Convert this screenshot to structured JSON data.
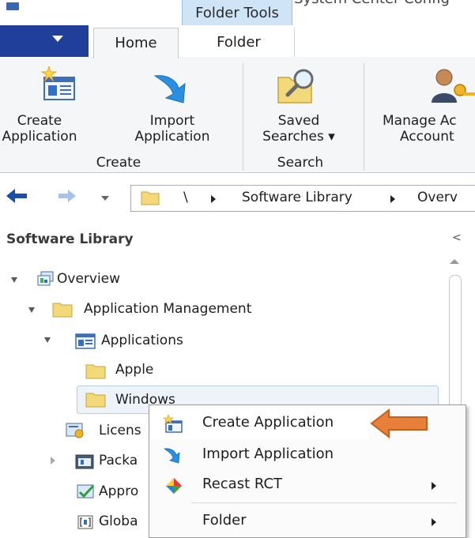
{
  "window": {
    "context_tab": "Folder Tools",
    "title_partial": "System Center Config"
  },
  "ribbon": {
    "tabs": [
      "Home",
      "Folder"
    ],
    "buttons": {
      "create_application": {
        "line1": "Create",
        "line2": "Application"
      },
      "import_application": {
        "line1": "Import",
        "line2": "Application"
      },
      "saved_searches": {
        "line1": "Saved",
        "line2": "Searches ▾"
      },
      "manage_accounts": {
        "line1": "Manage Ac",
        "line2": "Account"
      }
    },
    "groups": {
      "create": "Create",
      "search": "Search"
    }
  },
  "address": {
    "root": "\\",
    "crumbs": [
      "Software Library",
      "Overv"
    ]
  },
  "nav": {
    "header": "Software Library",
    "collapse": "<",
    "tree": {
      "overview": "Overview",
      "application_management": "Application Management",
      "applications": "Applications",
      "apple": "Apple",
      "windows": "Windows",
      "licenses": "Licens",
      "packages": "Packa",
      "approval": "Appro",
      "global": "Globa"
    }
  },
  "context_menu": {
    "items": [
      "Create Application",
      "Import Application",
      "Recast RCT",
      "Folder"
    ]
  },
  "colors": {
    "file_tab": "#1f3f9a",
    "context_tab": "#cfe4f7",
    "folder_yellow": "#f4d97a",
    "annotation_arrow": "#e8803a"
  }
}
